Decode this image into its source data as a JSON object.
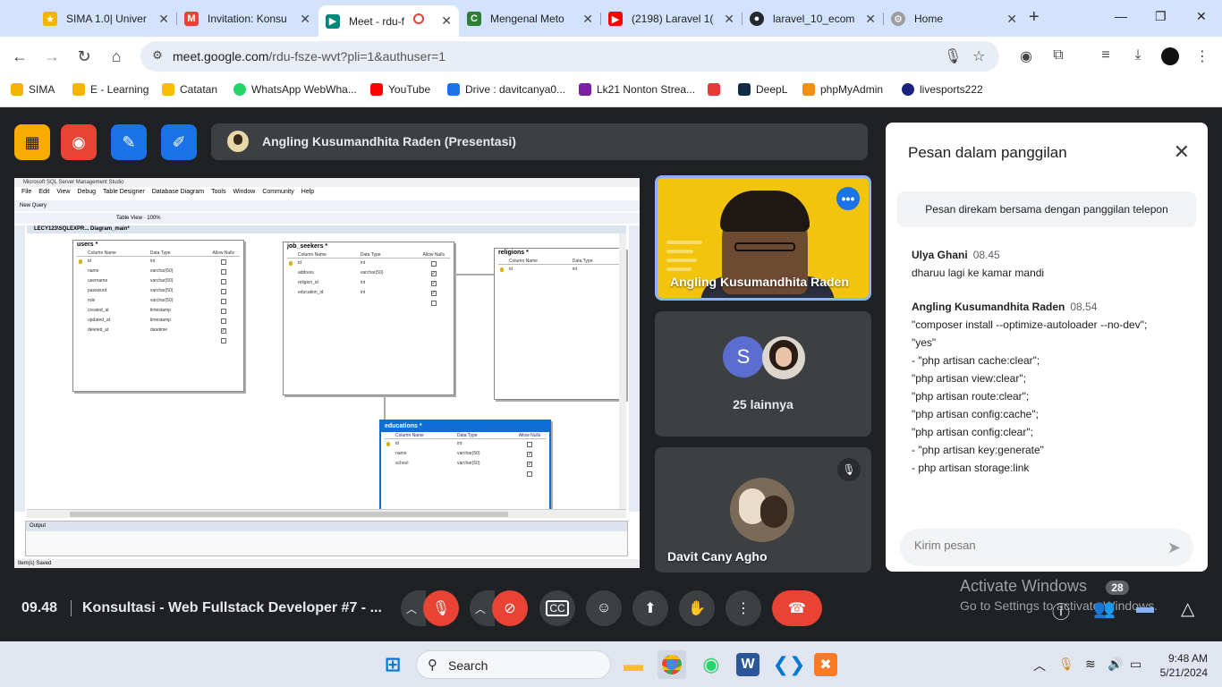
{
  "browser": {
    "tabs": [
      {
        "title": "SIMA 1.0| Univer",
        "color": "#f4b400"
      },
      {
        "title": "Invitation: Konsu",
        "color": "#ea4335"
      },
      {
        "title": "Meet - rdu-f",
        "color": "#00897b"
      },
      {
        "title": "Mengenal Meto",
        "color": "#2e7d32"
      },
      {
        "title": "(2198) Laravel 1(",
        "color": "#ff0000"
      },
      {
        "title": "laravel_10_ecom",
        "color": "#24292f"
      },
      {
        "title": "Home",
        "color": "#9e9e9e"
      }
    ],
    "url_host": "meet.google.com",
    "url_path": "/rdu-fsze-wvt?pli=1&authuser=1",
    "bookmarks": [
      {
        "label": "SIMA",
        "color": "#f4b400"
      },
      {
        "label": "E - Learning",
        "color": "#f4b400"
      },
      {
        "label": "Catatan",
        "color": "#fbbc04"
      },
      {
        "label": "WhatsApp WebWha...",
        "color": "#25d366"
      },
      {
        "label": "YouTube",
        "color": "#ff0000"
      },
      {
        "label": "Drive : davitcanya0...",
        "color": "#1a73e8"
      },
      {
        "label": "Lk21 Nonton Strea...",
        "color": "#7b1fa2"
      },
      {
        "label": "",
        "color": "#e53935"
      },
      {
        "label": "DeepL",
        "color": "#0f2b46"
      },
      {
        "label": "phpMyAdmin",
        "color": "#f29111"
      },
      {
        "label": "livesports222",
        "color": "#1a237e"
      }
    ]
  },
  "meet": {
    "presenter_label": "Angling Kusumandhita Raden (Presentasi)",
    "host_buttons": [
      {
        "name": "host-btn-1",
        "color": "#f9ab00"
      },
      {
        "name": "host-btn-2",
        "color": "#ea4335"
      },
      {
        "name": "host-btn-3",
        "color": "#1a73e8"
      },
      {
        "name": "host-btn-4",
        "color": "#1a73e8"
      }
    ],
    "tiles": {
      "presenter_name": "Angling Kusumandhita Raden",
      "others_initial": "S",
      "others_label": "25 lainnya",
      "third_name": "Davit Cany Agho"
    },
    "clock": "09.48",
    "meeting_title": "Konsultasi - Web Fullstack Developer #7 - ...",
    "chat_badge": "28",
    "watermark_title": "Activate Windows",
    "watermark_sub": "Go to Settings to activate Windows."
  },
  "ssms": {
    "title": "Microsoft SQL Server Management Studio",
    "menu": [
      "File",
      "Edit",
      "View",
      "Debug",
      "Table Designer",
      "Database Diagram",
      "Tools",
      "Window",
      "Community",
      "Help"
    ],
    "toolbar1": "New Query",
    "toolbar2": "Table View ·     100%",
    "doc_tab": "LECY123\\SQLEXPR...  Diagram_main*",
    "output_label": "Output",
    "status": "Item(s) Saved",
    "tables": [
      {
        "name": "users *",
        "headers": [
          "Column Name",
          "Data Type",
          "Allow Nulls"
        ],
        "rows": [
          {
            "col": "id",
            "type": "int",
            "null": false,
            "key": true
          },
          {
            "col": "name",
            "type": "varchar(50)",
            "null": false
          },
          {
            "col": "username",
            "type": "varchar(50)",
            "null": false
          },
          {
            "col": "password",
            "type": "varchar(50)",
            "null": false
          },
          {
            "col": "role",
            "type": "varchar(50)",
            "null": false
          },
          {
            "col": "created_at",
            "type": "timestamp",
            "null": false
          },
          {
            "col": "updated_at",
            "type": "timestamp",
            "null": false
          },
          {
            "col": "deleted_at",
            "type": "datetime",
            "null": true
          },
          {
            "col": "",
            "type": "",
            "null": false
          }
        ]
      },
      {
        "name": "job_seekers *",
        "headers": [
          "Column Name",
          "Data Type",
          "Allow Nulls"
        ],
        "rows": [
          {
            "col": "id",
            "type": "int",
            "null": false,
            "key": true
          },
          {
            "col": "address",
            "type": "varchar(50)",
            "null": true
          },
          {
            "col": "religion_id",
            "type": "int",
            "null": true
          },
          {
            "col": "education_id",
            "type": "int",
            "null": true
          },
          {
            "col": "",
            "type": "",
            "null": false
          }
        ]
      },
      {
        "name": "religions *",
        "headers": [
          "Column Name",
          "Data Type"
        ],
        "rows": [
          {
            "col": "id",
            "type": "int",
            "key": true
          }
        ]
      },
      {
        "name": "educations *",
        "headers": [
          "Column Name",
          "Data Type",
          "Allow Nulls"
        ],
        "rows": [
          {
            "col": "id",
            "type": "int",
            "null": false,
            "key": true
          },
          {
            "col": "name",
            "type": "varchar(50)",
            "null": true
          },
          {
            "col": "school",
            "type": "varchar(50)",
            "null": true
          },
          {
            "col": "",
            "type": "",
            "null": false
          }
        ]
      }
    ]
  },
  "chat": {
    "title": "Pesan dalam panggilan",
    "notice": "Pesan direkam bersama dengan panggilan telepon",
    "messages": [
      {
        "sender": "Ulya Ghani",
        "time": "08.45",
        "lines": [
          "dharuu lagi ke kamar mandi"
        ]
      },
      {
        "sender": "Angling Kusumandhita Raden",
        "time": "08.54",
        "lines": [
          "\"composer install --optimize-autoloader --no-dev\";",
          "\"yes\"",
          "- \"php artisan cache:clear\";",
          "\"php artisan view:clear\";",
          "\"php artisan route:clear\";",
          "\"php artisan config:cache\";",
          "\"php artisan config:clear\";",
          "- \"php artisan key:generate\"",
          "- php artisan storage:link"
        ]
      }
    ],
    "input_placeholder": "Kirim pesan"
  },
  "taskbar": {
    "search_label": "Search",
    "time": "9:48 AM",
    "date": "5/21/2024",
    "apps": [
      {
        "name": "file-explorer",
        "color": "#f6b93b"
      },
      {
        "name": "chrome",
        "color": "#4285f4"
      },
      {
        "name": "whatsapp",
        "color": "#25d366"
      },
      {
        "name": "word",
        "color": "#2b579a"
      },
      {
        "name": "vscode",
        "color": "#0078d4"
      },
      {
        "name": "xampp",
        "color": "#fb7a24"
      }
    ]
  }
}
